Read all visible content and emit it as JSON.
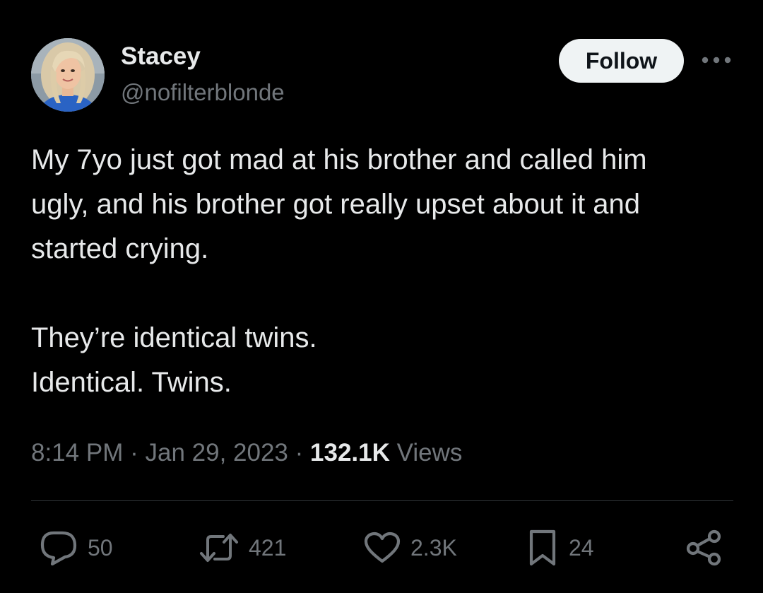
{
  "author": {
    "name": "Stacey",
    "handle": "@nofilterblonde",
    "avatar_icon": "profile-photo"
  },
  "header": {
    "follow_label": "Follow",
    "more_icon": "more-horizontal-icon"
  },
  "tweet": {
    "lines": [
      "My 7yo just got mad at his brother and called him",
      "ugly, and his brother got really upset about it and",
      "started crying.",
      "They’re identical twins.",
      "Identical. Twins."
    ]
  },
  "meta": {
    "time": "8:14 PM",
    "separator": "·",
    "date": "Jan 29, 2023",
    "views_count": "132.1K",
    "views_label": "Views"
  },
  "actions": {
    "reply": {
      "icon": "reply-icon",
      "count": "50"
    },
    "retweet": {
      "icon": "retweet-icon",
      "count": "421"
    },
    "like": {
      "icon": "heart-icon",
      "count": "2.3K"
    },
    "bookmark": {
      "icon": "bookmark-icon",
      "count": "24"
    },
    "share": {
      "icon": "share-icon"
    }
  },
  "colors": {
    "background": "#000000",
    "primary_text": "#e7e9ea",
    "secondary_text": "#71767b",
    "divider": "#2f3336",
    "follow_button_bg": "#eff3f4",
    "follow_button_text": "#0f1419"
  }
}
